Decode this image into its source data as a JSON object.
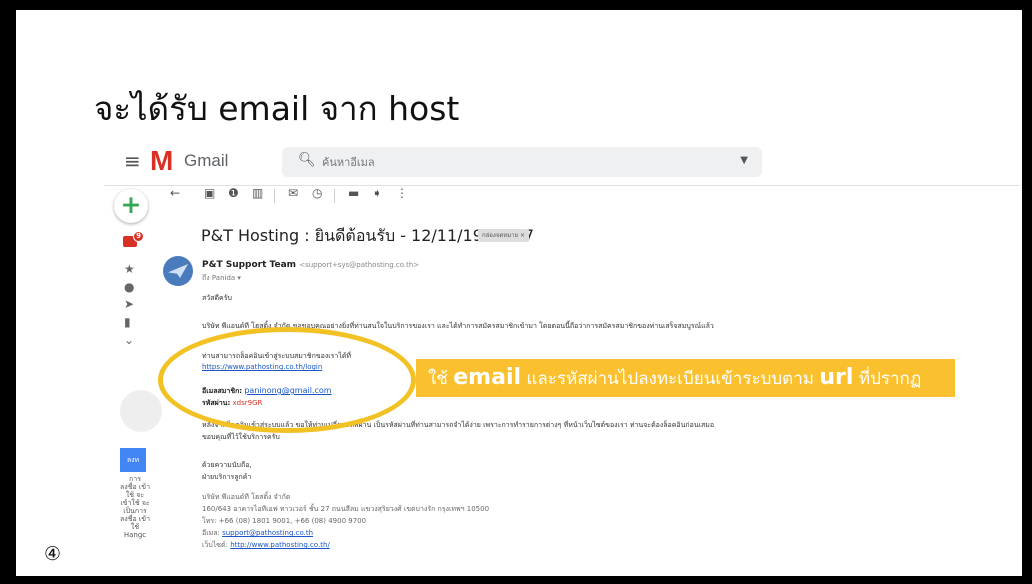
{
  "slide": {
    "title": "จะได้รับ email จาก host",
    "number": "④"
  },
  "gmail": {
    "app_name": "Gmail",
    "logo_letter": "M",
    "search_placeholder": "ค้นหาอีเมล",
    "compose_glyph": "+",
    "inbox_badge": "9"
  },
  "rail": {
    "blue_label": "ลงท",
    "side_text": "การ ลงชื่อ เข้าใช้ จะ เข้าใช้ จะ เป็นการ ลงชื่อ เข้าใช้ Hangc"
  },
  "email": {
    "subject": "P&T Hosting : ยินดีต้อนรับ - 12/11/19 09:27",
    "label_chip": "กล่องจดหมาย ×",
    "sender_name": "P&T Support Team",
    "sender_email": "<support+sys@pathosting.co.th>",
    "to_line": "ถึง Panida ▾",
    "greeting": "สวัสดีครับ",
    "para1": "บริษัท พีแอนด์ที โฮสติ้ง จำกัด ขอขอบคุณอย่างยิ่งที่ท่านสนใจในบริการของเรา และได้ทำการสมัครสมาชิกเข้ามา โดยตอนนี้ถือว่าการสมัครสมาชิกของท่านเสร็จสมบูรณ์แล้ว",
    "login_line": "ท่านสามารถล็อคอินเข้าสู่ระบบสมาชิกของเราได้ที่",
    "login_url": "https://www.pathosting.co.th/login",
    "member_label": "อีเมลสมาชิก:",
    "member_email": "paninong@gmail.com",
    "password_label": "รหัสผ่าน:",
    "password_value": "xdsr9GR",
    "para2": "หลังจากล็อคอินเข้าสู่ระบบแล้ว ขอให้ท่านเปลี่ยนรหัสผ่าน เป็นรหัสผ่านที่ท่านสามารถจำได้ง่าย เพราะการทำรายการต่างๆ ที่หน้าเว็บไซต์ของเรา ท่านจะต้องล็อคอินก่อนเสมอ",
    "para2b": "ขอบคุณที่ไว้ใช้บริการครับ",
    "closing1": "ด้วยความนับถือ,",
    "closing2": "ฝ่ายบริการลูกค้า",
    "sig_company": "บริษัท พีแอนด์ที โฮสติ้ง จำกัด",
    "sig_address": "160/643 อาคารไอทีเอฟ ทาวเวอร์ ชั้น 27 ถนนสีลม แขวงสุริยวงศ์ เขตบางรัก กรุงเทพฯ 10500",
    "sig_phone": "โทร: +66 (08) 1801 9001, +66 (08) 4900 9700",
    "sig_email_label": "อีเมล:",
    "sig_email": "support@pathosting.co.th",
    "sig_web_label": "เว็บไซต์:",
    "sig_web": "http://www.pathosting.co.th/"
  },
  "callout": {
    "part1": "ใช้ ",
    "bold1": "email",
    "part2": " และรหัสผ่านไปลงทะเบียนเข้าระบบตาม ",
    "bold2": "url",
    "part3": " ที่ปรากฏ"
  },
  "colors": {
    "gmail_red": "#d93025",
    "highlight_yellow": "#f2c224",
    "callout_bg": "#fbc02d",
    "link_blue": "#1a56c4"
  },
  "icons": {
    "menu": "hamburger-menu-icon",
    "search": "search-icon",
    "back": "back-arrow-icon",
    "archive": "archive-icon",
    "spam": "report-spam-icon",
    "delete": "trash-icon",
    "unread": "mark-unread-icon",
    "snooze": "snooze-clock-icon",
    "move": "move-to-folder-icon",
    "label": "label-icon",
    "more": "more-vertical-icon"
  }
}
